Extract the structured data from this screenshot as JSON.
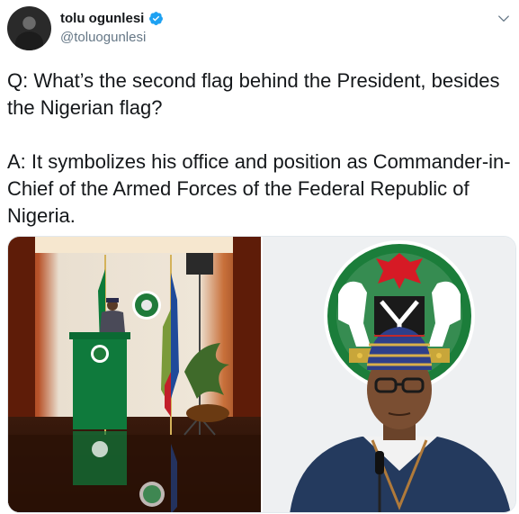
{
  "author": {
    "display_name": "tolu ogunlesi",
    "handle": "@toluogunlesi",
    "verified": true,
    "avatar_icon": "avatar-silhouette"
  },
  "tweet": {
    "question": "Q: What’s the second flag behind the President, besides the Nigerian flag?",
    "answer": "A: It symbolizes his office and position as Commander-in-Chief of the Armed Forces of the Federal Republic of Nigeria."
  },
  "media": {
    "photos": [
      {
        "name": "president-at-podium-photo"
      },
      {
        "name": "president-portrait-photo"
      }
    ]
  },
  "colors": {
    "verified_blue": "#1da1f2",
    "text": "#14171a",
    "secondary": "#657786",
    "nigeria_green": "#008751"
  },
  "icons": {
    "verified": "verified-badge-icon",
    "menu": "chevron-down-icon"
  }
}
